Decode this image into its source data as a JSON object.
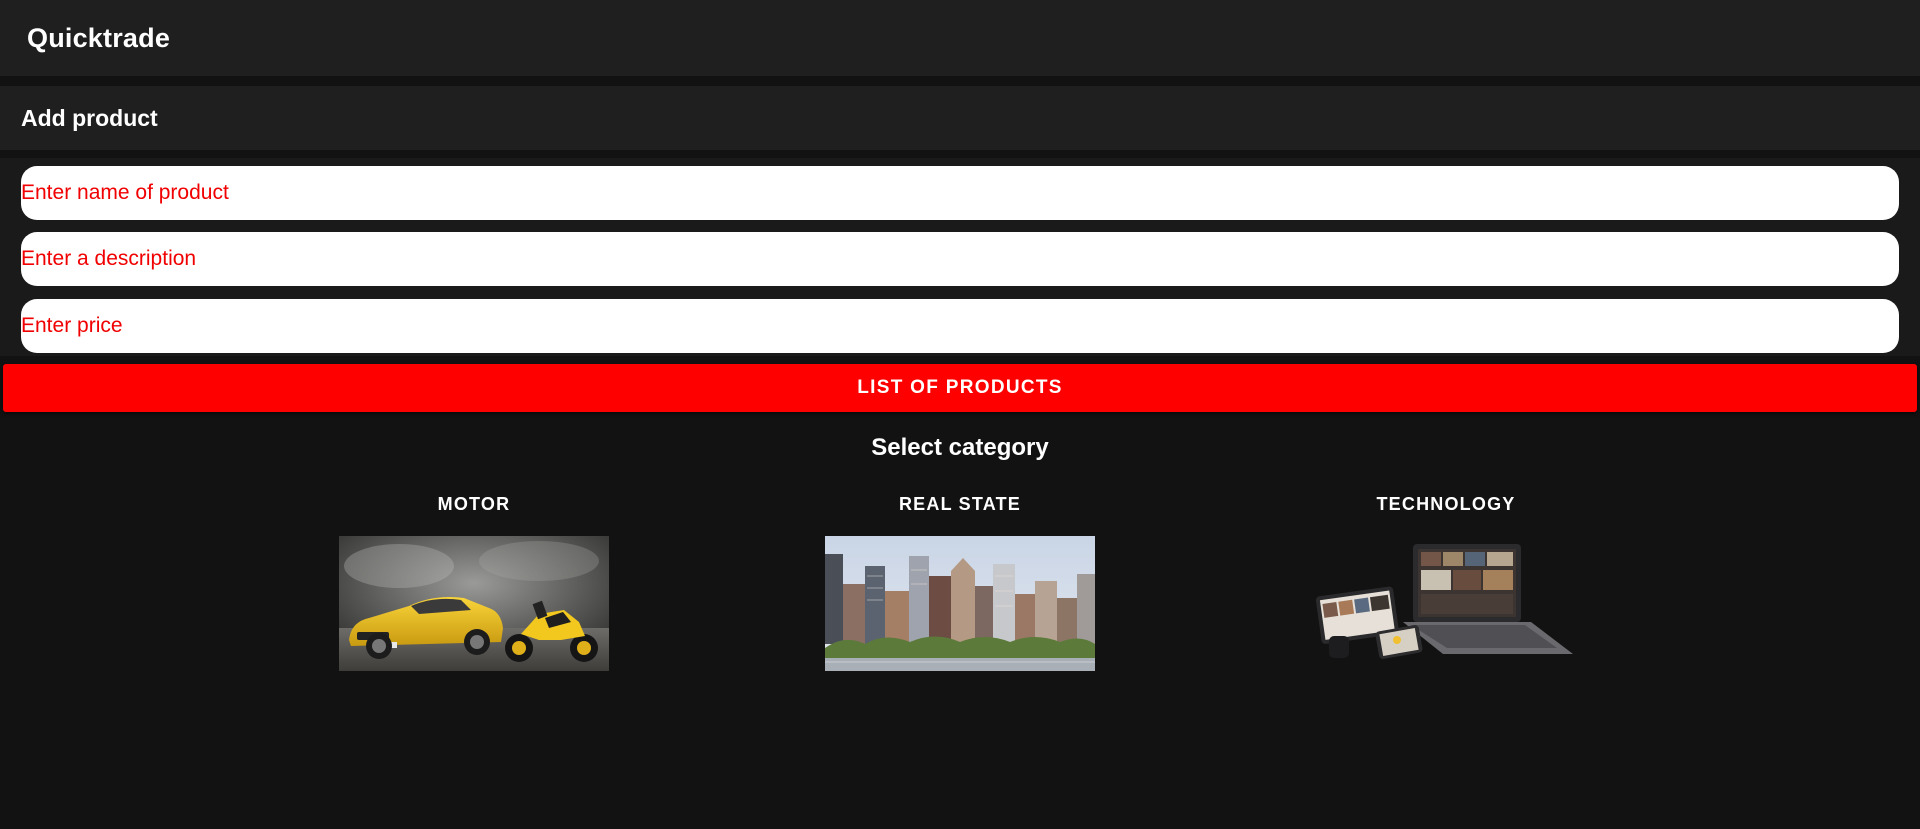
{
  "app": {
    "title": "Quicktrade"
  },
  "section": {
    "heading": "Add product"
  },
  "form": {
    "name_placeholder": "Enter name of product",
    "description_placeholder": "Enter a description",
    "price_placeholder": "Enter price",
    "name_value": "",
    "description_value": "",
    "price_value": ""
  },
  "actions": {
    "list_label": "LIST OF PRODUCTS"
  },
  "categories": {
    "title": "Select category",
    "items": [
      {
        "label": "MOTOR",
        "image": "sports-car-and-motorcycle-photo"
      },
      {
        "label": "REAL STATE",
        "image": "city-skyline-photo"
      },
      {
        "label": "TECHNOLOGY",
        "image": "laptop-and-devices-photo"
      }
    ]
  },
  "colors": {
    "background": "#121212",
    "toolbar": "#1f1f1f",
    "accent": "#ff0000",
    "placeholder": "#f00000"
  }
}
